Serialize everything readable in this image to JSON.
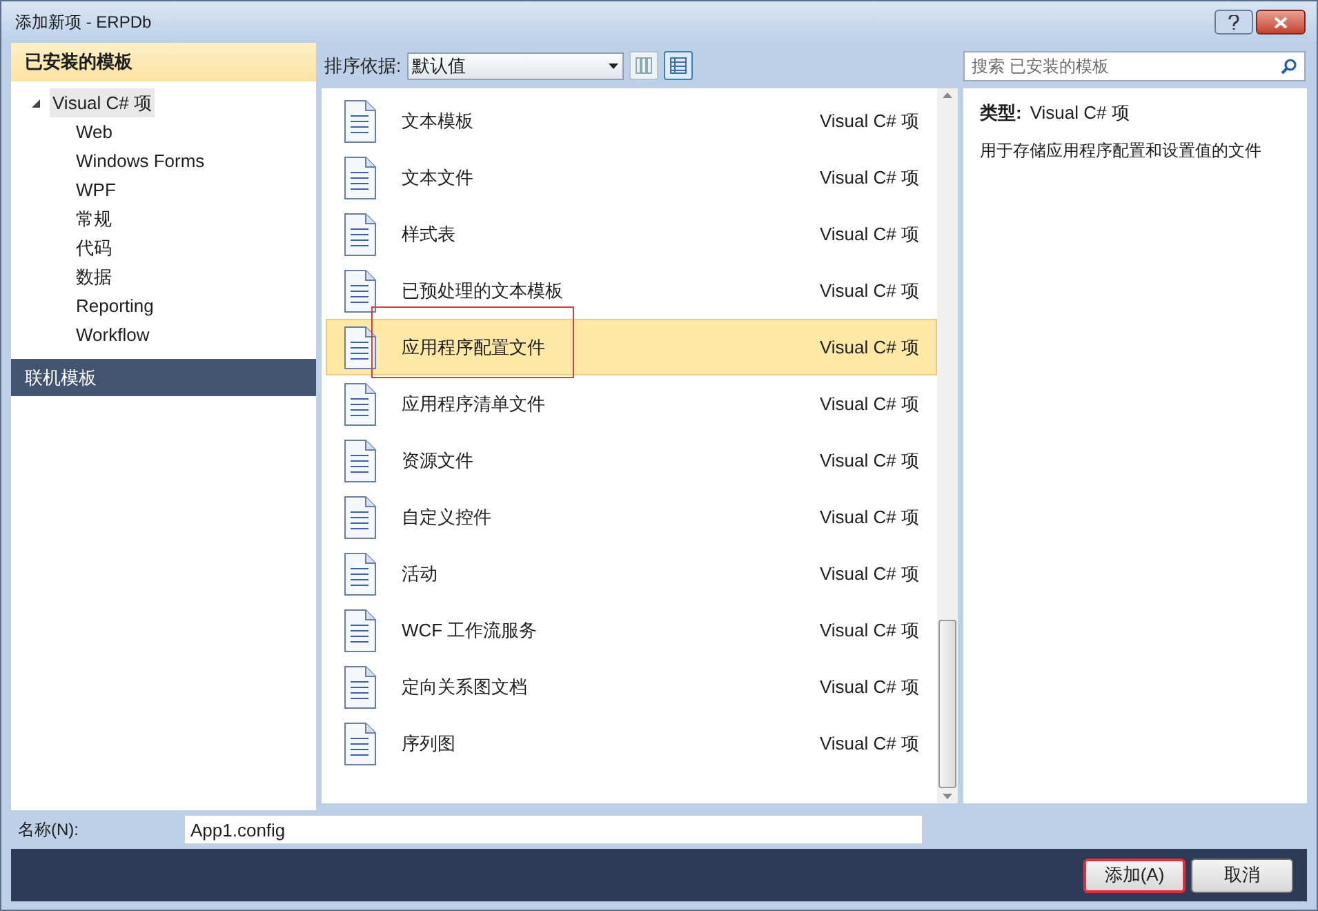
{
  "window": {
    "title": "添加新项 - ERPDb"
  },
  "sidebar": {
    "installed_header": "已安装的模板",
    "tree": [
      {
        "label": "Visual C# 项",
        "expanded": true,
        "selected": true,
        "children": [
          {
            "label": "Web",
            "selected": false
          },
          {
            "label": "Windows Forms",
            "selected": false
          },
          {
            "label": "WPF",
            "selected": false
          },
          {
            "label": "常规",
            "selected": false
          },
          {
            "label": "代码",
            "selected": false
          },
          {
            "label": "数据",
            "selected": false
          },
          {
            "label": "Reporting",
            "selected": false
          },
          {
            "label": "Workflow",
            "selected": false
          }
        ]
      }
    ],
    "online_header": "联机模板"
  },
  "toolbar": {
    "sort_label": "排序依据:",
    "sort_value": "默认值",
    "views": [
      {
        "kind": "list",
        "selected": false
      },
      {
        "kind": "details",
        "selected": true
      }
    ]
  },
  "search": {
    "placeholder": "搜索 已安装的模板"
  },
  "templates": [
    {
      "name": "文本模板",
      "type": "Visual C# 项",
      "selected": false,
      "highlighted": false
    },
    {
      "name": "文本文件",
      "type": "Visual C# 项",
      "selected": false,
      "highlighted": false
    },
    {
      "name": "样式表",
      "type": "Visual C# 项",
      "selected": false,
      "highlighted": false
    },
    {
      "name": "已预处理的文本模板",
      "type": "Visual C# 项",
      "selected": false,
      "highlighted": false
    },
    {
      "name": "应用程序配置文件",
      "type": "Visual C# 项",
      "selected": true,
      "highlighted": true
    },
    {
      "name": "应用程序清单文件",
      "type": "Visual C# 项",
      "selected": false,
      "highlighted": false
    },
    {
      "name": "资源文件",
      "type": "Visual C# 项",
      "selected": false,
      "highlighted": false
    },
    {
      "name": "自定义控件",
      "type": "Visual C# 项",
      "selected": false,
      "highlighted": false
    },
    {
      "name": "活动",
      "type": "Visual C# 项",
      "selected": false,
      "highlighted": false
    },
    {
      "name": "WCF 工作流服务",
      "type": "Visual C# 项",
      "selected": false,
      "highlighted": false
    },
    {
      "name": "定向关系图文档",
      "type": "Visual C# 项",
      "selected": false,
      "highlighted": false
    },
    {
      "name": "序列图",
      "type": "Visual C# 项",
      "selected": false,
      "highlighted": false
    }
  ],
  "details": {
    "type_label": "类型:",
    "type_value": "Visual C# 项",
    "description": "用于存储应用程序配置和设置值的文件"
  },
  "name_field": {
    "label": "名称(N):",
    "value": "App1.config"
  },
  "buttons": [
    {
      "label": "添加(A)",
      "highlighted": true
    },
    {
      "label": "取消",
      "highlighted": false
    }
  ]
}
